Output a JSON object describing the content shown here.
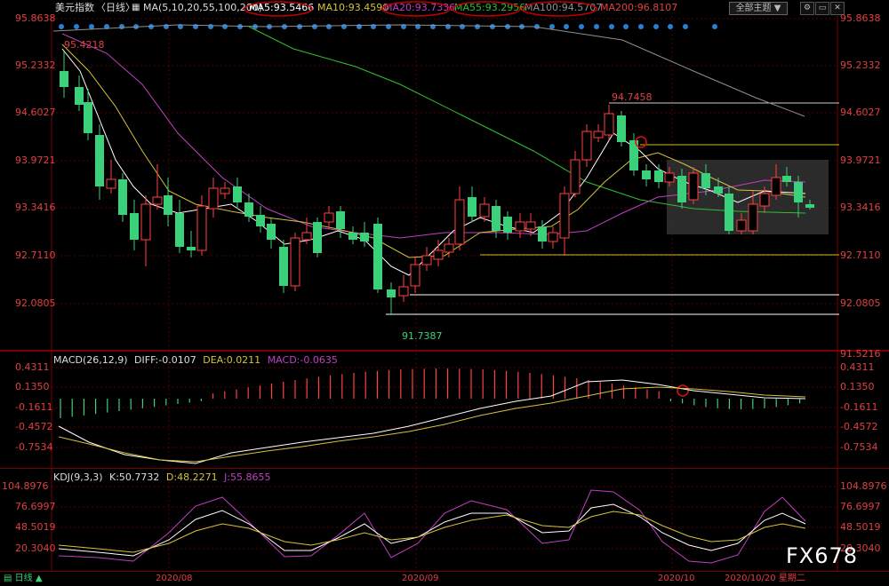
{
  "header": {
    "title": "美元指数",
    "period": "日线",
    "ma_title": "MA(5,10,20,55,100,200)",
    "ma5": "MA5:93.5466",
    "ma10": "MA10:93.4590",
    "ma20": "MA20:93.7336",
    "ma55": "MA55:93.2956",
    "ma100": "MA100:94.5707",
    "ma200": "MA200:96.8107",
    "theme_button": "全部主题"
  },
  "colors": {
    "up": "#ff4040",
    "down": "#3ad17a",
    "ma5": "#ffffff",
    "ma10": "#d4c33a",
    "ma20": "#c040c0",
    "ma55": "#30c030",
    "ma100": "#909090",
    "ma200": "#5080ff",
    "axis_red": "#e04040",
    "highlight_circle": "#e01010"
  },
  "price_axis": [
    "95.8638",
    "95.2332",
    "94.6027",
    "93.9721",
    "93.3416",
    "92.7110",
    "92.0805"
  ],
  "annotations": {
    "high_label": "95.4218",
    "peak_label": "94.7458",
    "low_label": "91.7387"
  },
  "macd": {
    "title": "MACD(26,12,9)",
    "diff": "DIFF:-0.0107",
    "dea": "DEA:0.0211",
    "macd": "MACD:-0.0635",
    "axis": [
      "0.4311",
      "0.1350",
      "-0.1611",
      "-0.4572",
      "-0.7534"
    ],
    "top_value": "91.5216"
  },
  "kdj": {
    "title": "KDJ(9,3,3)",
    "k": "K:50.7732",
    "d": "D:48.2271",
    "j": "J:55.8655",
    "axis": [
      "104.8976",
      "76.6997",
      "48.5019",
      "20.3040"
    ]
  },
  "time_axis": {
    "period_tab": "日线",
    "labels": [
      "2020/08",
      "2020/09",
      "2020/10"
    ],
    "current": "2020/10/20 星期二"
  },
  "watermark": "FX678",
  "chart_data": {
    "type": "candlestick",
    "title": "美元指数 日线",
    "ylim": [
      91.5216,
      95.8638
    ],
    "annotations": [
      {
        "label": "95.4218"
      },
      {
        "label": "94.7458"
      },
      {
        "label": "91.7387"
      }
    ]
  }
}
